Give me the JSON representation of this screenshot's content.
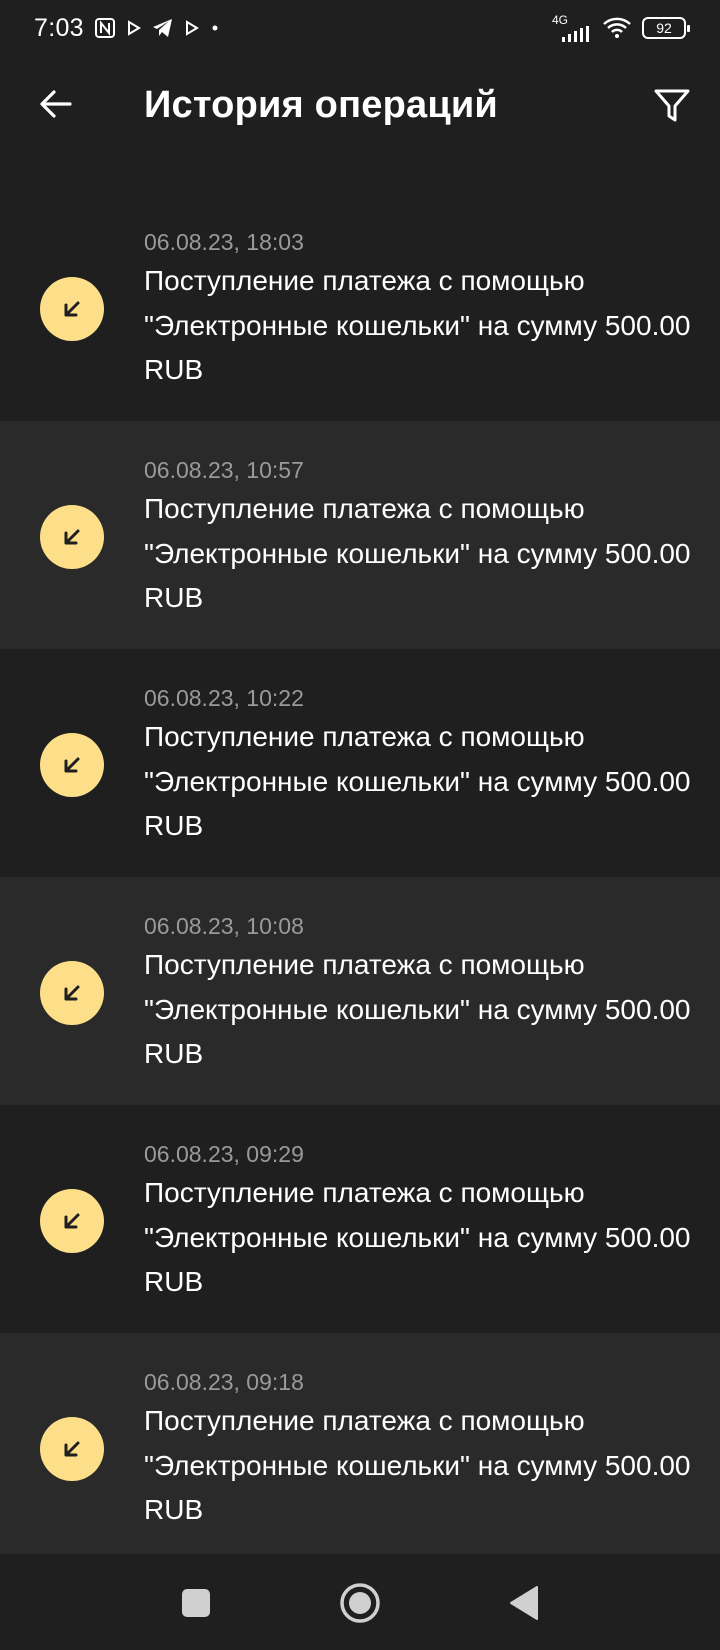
{
  "status_bar": {
    "time": "7:03",
    "network": "4G",
    "battery": "92",
    "icons": [
      "nfc-icon",
      "play-icon",
      "telegram-icon",
      "play-icon",
      "dot-icon",
      "signal-icon",
      "wifi-icon",
      "battery-icon"
    ]
  },
  "header": {
    "title": "История операций",
    "back_icon": "arrow-left-icon",
    "filter_icon": "filter-icon"
  },
  "transactions": [
    {
      "date": "06.08.23, 18:03",
      "text": "Поступление платежа с помощью \"Электронные кошельки\" на сумму 500.00 RUB",
      "icon": "incoming-arrow-icon"
    },
    {
      "date": "06.08.23, 10:57",
      "text": "Поступление платежа с помощью \"Электронные кошельки\" на сумму 500.00 RUB",
      "icon": "incoming-arrow-icon"
    },
    {
      "date": "06.08.23, 10:22",
      "text": "Поступление платежа с помощью \"Электронные кошельки\" на сумму 500.00 RUB",
      "icon": "incoming-arrow-icon"
    },
    {
      "date": "06.08.23, 10:08",
      "text": "Поступление платежа с помощью \"Электронные кошельки\" на сумму 500.00 RUB",
      "icon": "incoming-arrow-icon"
    },
    {
      "date": "06.08.23, 09:29",
      "text": "Поступление платежа с помощью \"Электронные кошельки\" на сумму 500.00 RUB",
      "icon": "incoming-arrow-icon"
    },
    {
      "date": "06.08.23, 09:18",
      "text": "Поступление платежа с помощью \"Электронные кошельки\" на сумму 500.00 RUB",
      "icon": "incoming-arrow-icon"
    }
  ],
  "nav_bar": {
    "icons": [
      "recent-apps-icon",
      "home-icon",
      "back-triangle-icon"
    ]
  },
  "colors": {
    "background": "#1f1f1f",
    "row_alt": "#2a2a2a",
    "accent": "#fddf8a",
    "secondary_text": "#9a9a9a"
  }
}
